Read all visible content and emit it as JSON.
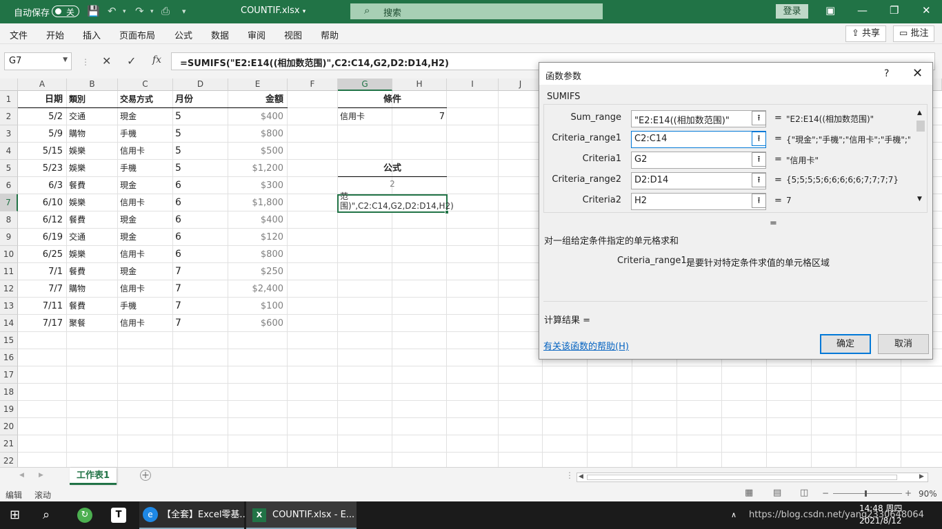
{
  "titlebar": {
    "autosave_label": "自动保存",
    "autosave_state": "关",
    "filename": "COUNTIF.xlsx",
    "search_placeholder": "搜索",
    "login_label": "登录"
  },
  "menu": {
    "items": [
      "文件",
      "开始",
      "插入",
      "页面布局",
      "公式",
      "数据",
      "审阅",
      "视图",
      "帮助"
    ],
    "share_label": "共享",
    "comment_label": "批注"
  },
  "formula_bar": {
    "name_box": "G7",
    "formula": "=SUMIFS(\"E2:E14((相加数范围)\",C2:C14,G2,D2:D14,H2)"
  },
  "grid": {
    "columns": [
      "A",
      "B",
      "C",
      "D",
      "E",
      "F",
      "G",
      "H",
      "I",
      "J"
    ],
    "rows": [
      "1",
      "2",
      "3",
      "4",
      "5",
      "6",
      "7",
      "8",
      "9",
      "10",
      "11",
      "12",
      "13",
      "14",
      "15",
      "16",
      "17",
      "18",
      "19",
      "20",
      "21",
      "22"
    ],
    "header": {
      "A": "日期",
      "B": "類別",
      "C": "交易方式",
      "D": "月份",
      "E": "金額"
    },
    "data": [
      {
        "A": "5/2",
        "B": "交通",
        "C": "現金",
        "D": "5",
        "E": "$400"
      },
      {
        "A": "5/9",
        "B": "購物",
        "C": "手機",
        "D": "5",
        "E": "$800"
      },
      {
        "A": "5/15",
        "B": "娛樂",
        "C": "信用卡",
        "D": "5",
        "E": "$500"
      },
      {
        "A": "5/23",
        "B": "娛樂",
        "C": "手機",
        "D": "5",
        "E": "$1,200"
      },
      {
        "A": "6/3",
        "B": "餐費",
        "C": "現金",
        "D": "6",
        "E": "$300"
      },
      {
        "A": "6/10",
        "B": "娛樂",
        "C": "信用卡",
        "D": "6",
        "E": "$1,800"
      },
      {
        "A": "6/12",
        "B": "餐費",
        "C": "現金",
        "D": "6",
        "E": "$400"
      },
      {
        "A": "6/19",
        "B": "交通",
        "C": "現金",
        "D": "6",
        "E": "$120"
      },
      {
        "A": "6/25",
        "B": "娛樂",
        "C": "信用卡",
        "D": "6",
        "E": "$800"
      },
      {
        "A": "7/1",
        "B": "餐費",
        "C": "現金",
        "D": "7",
        "E": "$250"
      },
      {
        "A": "7/7",
        "B": "購物",
        "C": "信用卡",
        "D": "7",
        "E": "$2,400"
      },
      {
        "A": "7/11",
        "B": "餐費",
        "C": "手機",
        "D": "7",
        "E": "$100"
      },
      {
        "A": "7/17",
        "B": "聚餐",
        "C": "信用卡",
        "D": "7",
        "E": "$600"
      }
    ],
    "conditions_title": "條件",
    "cond_g2": "信用卡",
    "cond_h2": "7",
    "formula_title": "公式",
    "g6_value": "2",
    "g7_edit_text": "范围)\",C2:C14,G2,D2:D14,H2)"
  },
  "sheet_tab": "工作表1",
  "status": {
    "mode": "编辑",
    "scroll": "滚动",
    "zoom": "90%"
  },
  "taskbar": {
    "app1": "【全套】Excel零基...",
    "app2": "COUNTIF.xlsx - E...",
    "time": "14:48 周四",
    "date": "2021/8/12",
    "watermark": "https://blog.csdn.net/yang2330648064"
  },
  "dialog": {
    "title": "函数参数",
    "help_q": "?",
    "function_name": "SUMIFS",
    "args": [
      {
        "label": "Sum_range",
        "value": "\"E2:E14((相加数范围)\"",
        "result": "\"E2:E14((相加数范围)\""
      },
      {
        "label": "Criteria_range1",
        "value": "C2:C14",
        "result": "{\"現金\";\"手機\";\"信用卡\";\"手機\";\"..."
      },
      {
        "label": "Criteria1",
        "value": "G2",
        "result": "\"信用卡\""
      },
      {
        "label": "Criteria_range2",
        "value": "D2:D14",
        "result": "{5;5;5;5;6;6;6;6;6;7;7;7;7}"
      },
      {
        "label": "Criteria2",
        "value": "H2",
        "result": "7"
      }
    ],
    "eq": "=",
    "description": "对一组给定条件指定的单元格求和",
    "arg_desc_name": "Criteria_range1:",
    "arg_desc_text": "是要针对特定条件求值的单元格区域",
    "calc_result_label": "计算结果 =",
    "help_link": "有关该函数的帮助(H)",
    "ok_label": "确定",
    "cancel_label": "取消"
  }
}
